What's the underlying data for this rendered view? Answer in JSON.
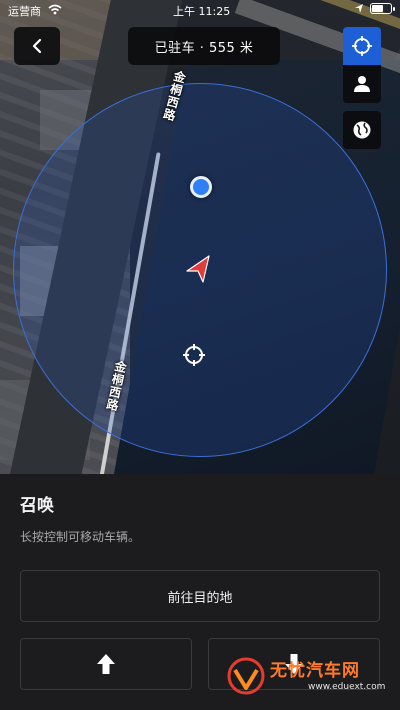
{
  "status_bar": {
    "carrier": "运营商",
    "time": "上午 11:25"
  },
  "header": {
    "title": "已驻车 · 555 米"
  },
  "map": {
    "street_name": "金桐西路"
  },
  "panel": {
    "title": "召唤",
    "description": "长按控制可移动车辆。",
    "destination_label": "前往目的地"
  },
  "watermark": {
    "text": "无忧汽车网",
    "sub": "www.eduext.com"
  },
  "colors": {
    "accent_blue": "#1f5fd6",
    "car_arrow": "#e23b3b",
    "panel_bg": "#1c1c1e"
  },
  "icons": {
    "back": "chevron-left-icon",
    "summon_target": "crosshair-icon",
    "person": "person-icon",
    "globe": "globe-icon",
    "forward": "arrow-up-icon",
    "backward": "arrow-down-icon"
  }
}
